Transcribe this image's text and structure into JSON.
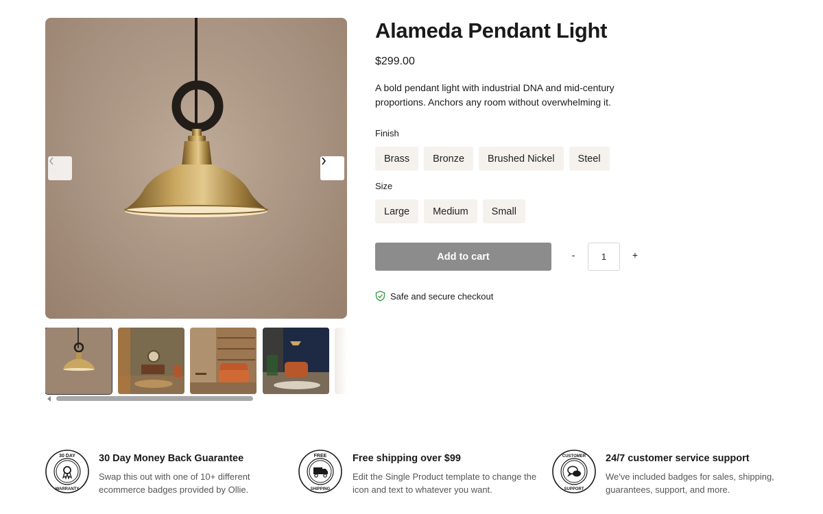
{
  "product": {
    "title": "Alameda Pendant Light",
    "price": "$299.00",
    "description": "A bold pendant light with industrial DNA and mid-century proportions. Anchors any room without overwhelming it."
  },
  "options": {
    "finish": {
      "label": "Finish",
      "values": [
        "Brass",
        "Bronze",
        "Brushed Nickel",
        "Steel"
      ]
    },
    "size": {
      "label": "Size",
      "values": [
        "Large",
        "Medium",
        "Small"
      ]
    }
  },
  "cart": {
    "add_label": "Add to cart",
    "minus": "-",
    "plus": "+",
    "quantity": "1"
  },
  "secure": {
    "text": "Safe and secure checkout",
    "icon": "shield-check-icon",
    "color": "#3f9a4c"
  },
  "gallery": {
    "prev_icon": "chevron-left-icon",
    "next_icon": "chevron-right-icon",
    "thumbnail_count_visible": 5
  },
  "badges": [
    {
      "icon": "warranty-badge-icon",
      "ring_top": "30 DAY",
      "ring_bottom": "WARRANTY",
      "title": "30 Day Money Back Guarantee",
      "text": "Swap this out with one of 10+ different ecommerce badges provided by Ollie."
    },
    {
      "icon": "free-shipping-badge-icon",
      "ring_top": "FREE",
      "ring_bottom": "SHIPPING",
      "title": "Free shipping over $99",
      "text": "Edit the Single Product template to change the icon and text to whatever you want."
    },
    {
      "icon": "customer-support-badge-icon",
      "ring_top": "CUSTOMER",
      "ring_bottom": "SUPPORT",
      "title": "24/7 customer service support",
      "text": "We've included badges for sales, shipping, guarantees, support, and more."
    }
  ],
  "colors": {
    "button_bg": "#8c8c8c",
    "option_bg": "#f5f2ee",
    "image_bg": "#a79180"
  }
}
